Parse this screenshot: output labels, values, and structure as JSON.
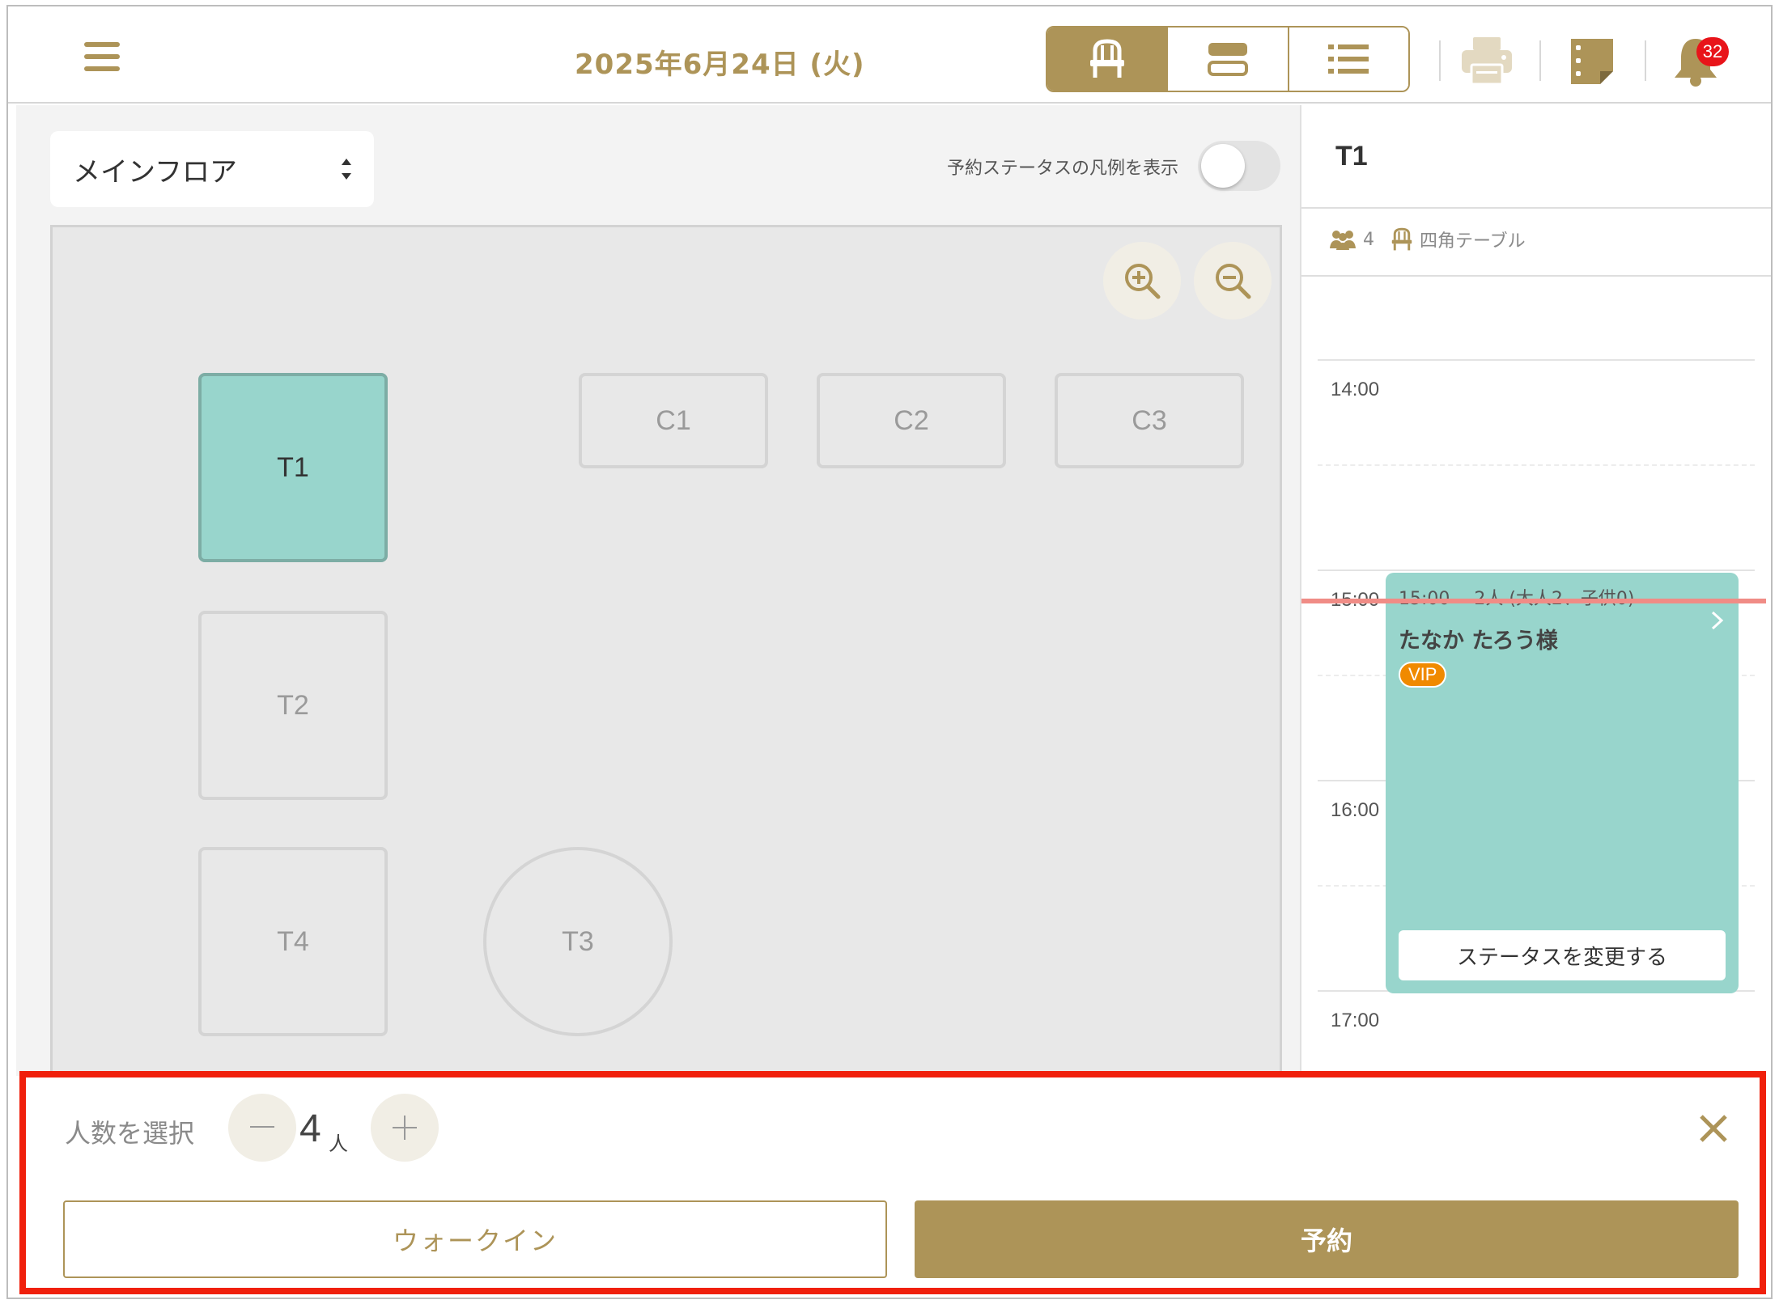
{
  "header": {
    "date": "2025年6月24日 (火)",
    "notification_count": "32",
    "accent_color": "#ad9458",
    "badge_color": "#e8141a"
  },
  "floor": {
    "selected_floor": "メインフロア",
    "legend_toggle_label": "予約ステータスの凡例を表示",
    "legend_toggle_on": false,
    "tables": [
      {
        "id": "T1",
        "shape": "square",
        "selected": true
      },
      {
        "id": "C1",
        "shape": "rect",
        "selected": false
      },
      {
        "id": "C2",
        "shape": "rect",
        "selected": false
      },
      {
        "id": "C3",
        "shape": "rect",
        "selected": false
      },
      {
        "id": "T2",
        "shape": "square",
        "selected": false
      },
      {
        "id": "T4",
        "shape": "square",
        "selected": false
      },
      {
        "id": "T3",
        "shape": "round",
        "selected": false
      }
    ],
    "selected_color": "#98d5cc"
  },
  "side": {
    "table_name": "T1",
    "capacity": "4",
    "table_type": "四角テーブル",
    "times": [
      "14:00",
      "15:00",
      "16:00",
      "17:00"
    ],
    "reservation": {
      "summary": "15:00-　2人 (大人2、子供0)",
      "name": "たなか たろう様",
      "badge": "VIP",
      "status_button": "ステータスを変更する"
    }
  },
  "bottom": {
    "count_label": "人数を選択",
    "count": "4",
    "count_unit": "人",
    "walkin_label": "ウォークイン",
    "reserve_label": "予約",
    "highlight_color": "#f0200c"
  }
}
